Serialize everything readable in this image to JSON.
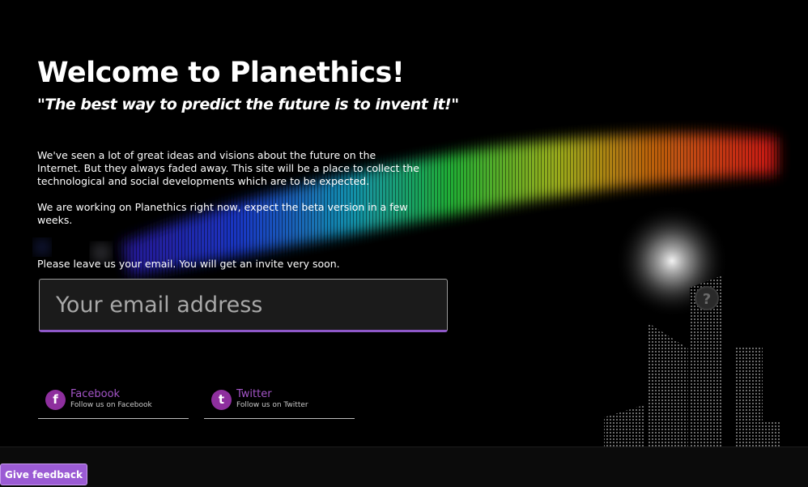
{
  "hero": {
    "title": "Welcome to Planethics!",
    "quote": "\"The best way to predict the future is to invent it!\""
  },
  "intro": {
    "paragraph1": "We've seen a lot of great ideas and visions about the future on the Internet. But they always faded away. This site will be a place to collect the technological and social developments which are to be expected.",
    "paragraph2": "We are working on Planethics right now, expect the beta version in a few weeks.",
    "email_prompt": "Please leave us your email. You will get an invite very soon."
  },
  "signup": {
    "email_placeholder": "Your email address",
    "email_value": ""
  },
  "social": [
    {
      "name": "Facebook",
      "sub": "Follow us on Facebook",
      "icon": "facebook-icon",
      "glyph": "f"
    },
    {
      "name": "Twitter",
      "sub": "Follow us on Twitter",
      "icon": "twitter-icon",
      "glyph": "t"
    }
  ],
  "feedback": {
    "label": "Give feedback"
  },
  "colors": {
    "accent": "#9b5bd4",
    "social_icon": "#8e2f9e",
    "social_text": "#a455c8",
    "input_underline": "#8e58c8"
  }
}
